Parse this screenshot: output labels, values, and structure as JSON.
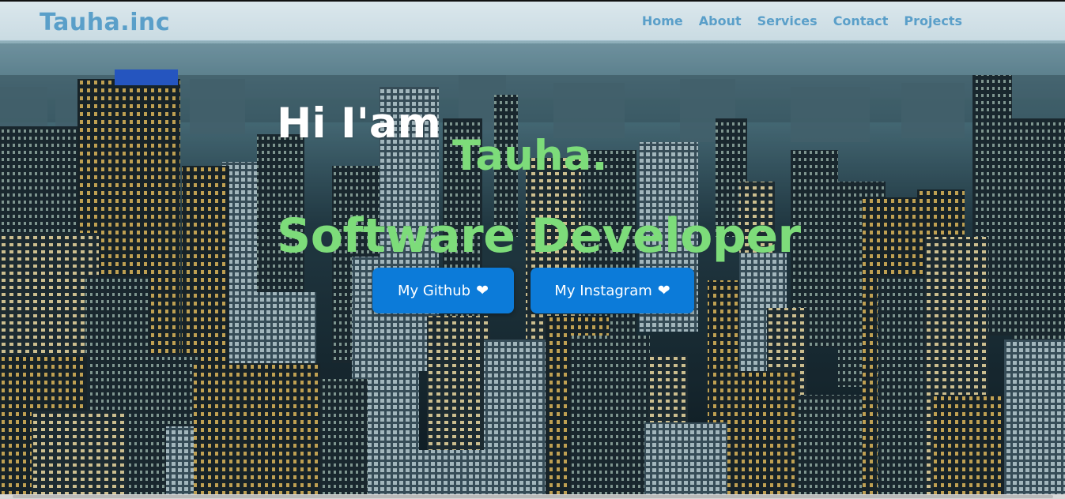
{
  "navbar": {
    "brand": "Tauha.inc",
    "links": [
      {
        "label": "Home"
      },
      {
        "label": "About"
      },
      {
        "label": "Services"
      },
      {
        "label": "Contact"
      },
      {
        "label": "Projects"
      }
    ]
  },
  "hero": {
    "greeting": "Hi I'am",
    "name": "Tauha.",
    "role": "Software Developer",
    "buttons": {
      "github_label": "My Github",
      "instagram_label": "My Instagram",
      "icon": "heart-icon"
    }
  },
  "colors": {
    "accent_blue": "#5a9fc9",
    "accent_green": "#7ddc7a",
    "button_blue": "#0c7bd9"
  }
}
